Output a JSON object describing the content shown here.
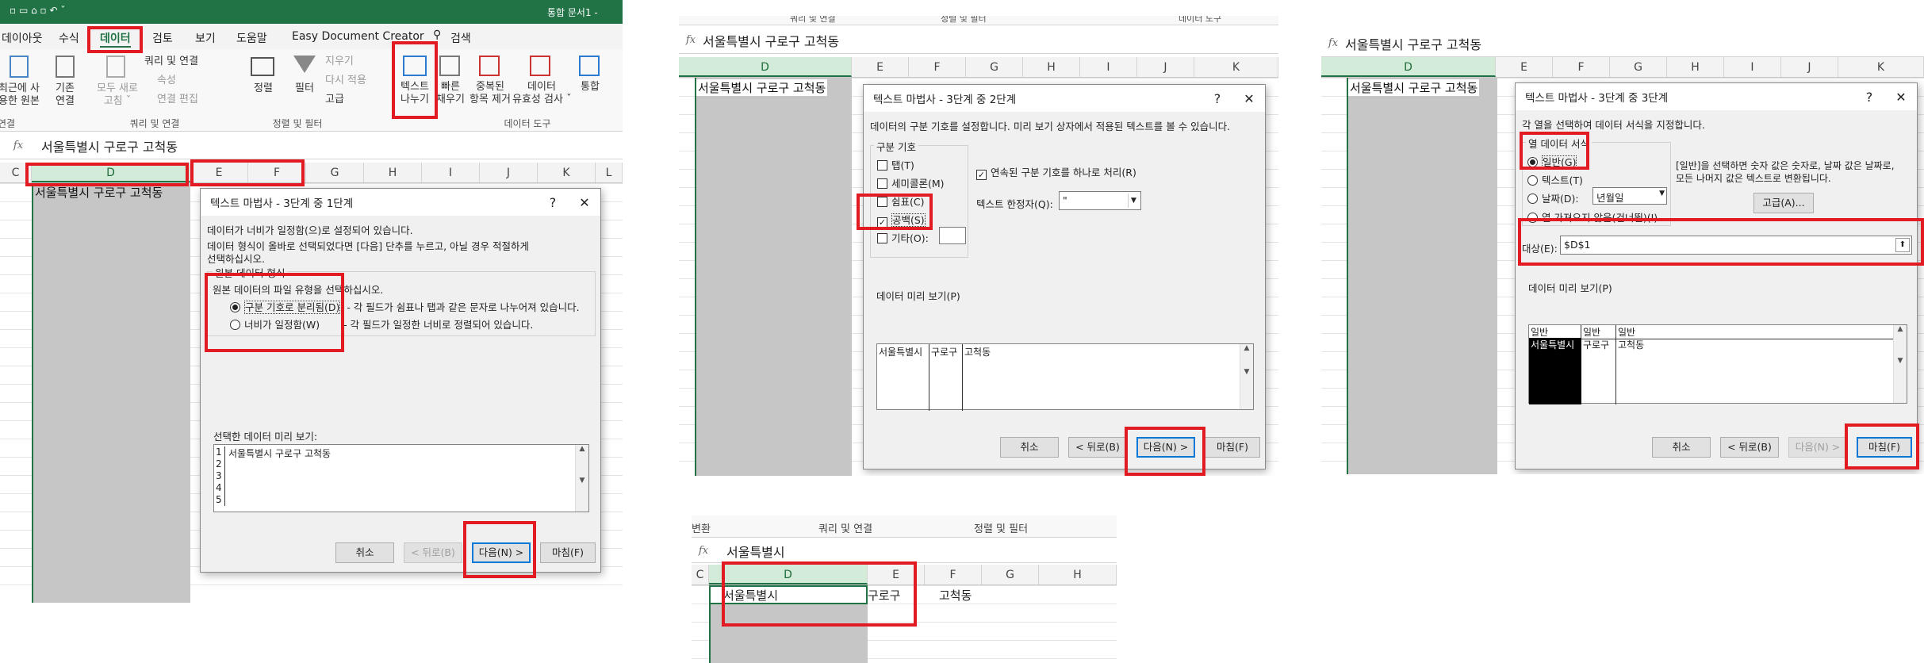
{
  "panel1": {
    "qat_title": "통합 문서1 -",
    "tabs": [
      "데이아웃",
      "수식",
      "데이터",
      "검토",
      "보기",
      "도움말",
      "Easy Document Creator"
    ],
    "search_label": "검색",
    "ribbon": {
      "recent_source": "최근에 사\n용한 원본",
      "existing_conn": "기존\n연결",
      "refresh_all": "모두 새로\n고침 ˇ",
      "queries_conn": "쿼리 및 연결",
      "properties": "속성",
      "edit_links": "연결 편집",
      "sort": "정렬",
      "filter": "필터",
      "clear": "지우기",
      "reapply": "다시 적용",
      "advanced": "고급",
      "text_to_columns": "텍스트\n나누기",
      "flash_fill": "빠른\n채우기",
      "remove_dup": "중복된\n항목 제거",
      "data_validation": "데이터\n유효성 검사 ˇ",
      "consolidate": "통합",
      "group_conn_label": "연결",
      "group_query_label": "쿼리 및 연결",
      "group_sort_label": "정렬 및 필터",
      "group_tools_label": "데이터 도구"
    },
    "formula": "서울특별시 구로구 고척동",
    "columns": [
      "C",
      "D",
      "E",
      "F",
      "G",
      "H",
      "I",
      "J",
      "K",
      "L"
    ],
    "cell_d1": "서울특별시 구로구 고척동",
    "dialog": {
      "title": "텍스트 마법사 - 3단계 중 1단계",
      "help": "?",
      "close": "✕",
      "line1": "데이터가 너비가 일정함(으)로 설정되어 있습니다.",
      "line2": "데이터 형식이 올바로 선택되었다면 [다음] 단추를 누르고, 아닐 경우 적절하게",
      "line3": "선택하십시오.",
      "group_label": "원본 데이터 형식",
      "group_inner": "원본 데이터의 파일 유형을 선택하십시오.",
      "opt1": "구분 기호로 분리됨(D)",
      "opt1_desc": "- 각 필드가 쉼표나 탭과 같은 문자로 나누어져 있습니다.",
      "opt2": "너비가 일정함(W)",
      "opt2_desc": "- 각 필드가 일정한 너비로 정렬되어 있습니다.",
      "preview_label": "선택한 데이터 미리 보기:",
      "preview_rows": [
        "1",
        "2",
        "3",
        "4",
        "5"
      ],
      "preview_first": "서울특별시 구로구 고척동",
      "cancel": "취소",
      "back": "< 뒤로(B)",
      "next": "다음(N) >",
      "finish": "마침(F)"
    }
  },
  "panel2": {
    "top_groups": [
      "쿼리 및 연결",
      "정렬 및 필터",
      "데이터 도구"
    ],
    "formula": "서울특별시 구로구 고척동",
    "columns": [
      "D",
      "E",
      "F",
      "G",
      "H",
      "I",
      "J",
      "K"
    ],
    "cell_d1": "서울특별시 구로구 고척동",
    "dialog": {
      "title": "텍스트 마법사 - 3단계 중 2단계",
      "help": "?",
      "close": "✕",
      "intro": "데이터의 구분 기호를 설정합니다. 미리 보기 상자에서 적용된 텍스트를 볼 수 있습니다.",
      "delim_label": "구분 기호",
      "tab": "탭(T)",
      "semicolon": "세미콜론(M)",
      "comma": "쉼표(C)",
      "space": "공백(S)",
      "other": "기타(O):",
      "consecutive": "연속된 구분 기호를 하나로 처리(R)",
      "qualifier_label": "텍스트 한정자(Q):",
      "qualifier_value": "\"",
      "preview_label": "데이터 미리 보기(P)",
      "preview_cols": [
        "서울특별시",
        "구로구",
        "고척동"
      ],
      "cancel": "취소",
      "back": "< 뒤로(B)",
      "next": "다음(N) >",
      "finish": "마침(F)"
    }
  },
  "panel3": {
    "formula": "서울특별시 구로구 고척동",
    "columns": [
      "D",
      "E",
      "F",
      "G",
      "H",
      "I",
      "J",
      "K"
    ],
    "cell_d1": "서울특별시 구로구 고척동",
    "dialog": {
      "title": "텍스트 마법사 - 3단계 중 3단계",
      "help": "?",
      "close": "✕",
      "intro": "각 열을 선택하여 데이터 서식을 지정합니다.",
      "format_label": "열 데이터 서식",
      "general": "일반(G)",
      "text": "텍스트(T)",
      "date": "날짜(D):",
      "date_value": "년월일",
      "skip": "열 가져오지 않음(건너뜀)(I)",
      "note": "[일반]을 선택하면 숫자 값은 숫자로, 날짜 값은 날짜로,\n모든 나머지 값은 텍스트로 변환됩니다.",
      "advanced": "고급(A)...",
      "dest_label": "대상(E):",
      "dest_value": "$D$1",
      "preview_label": "데이터 미리 보기(P)",
      "preview_headers": [
        "일반",
        "일반",
        "일반"
      ],
      "preview_cols": [
        "서울특별시",
        "구로구",
        "고척동"
      ],
      "cancel": "취소",
      "back": "< 뒤로(B)",
      "next": "다음(N) >",
      "finish": "마침(F)"
    }
  },
  "panel4": {
    "groups": [
      "변환",
      "쿼리 및 연결",
      "정렬 및 필터"
    ],
    "formula": "서울특별시",
    "columns": [
      "C",
      "D",
      "E",
      "F",
      "G",
      "H"
    ],
    "cells": [
      "서울특별시",
      "구로구",
      "고척동"
    ]
  },
  "colors": {
    "excel_green": "#217346",
    "highlight_red": "#e21b23",
    "select_blue": "#0078d7"
  }
}
